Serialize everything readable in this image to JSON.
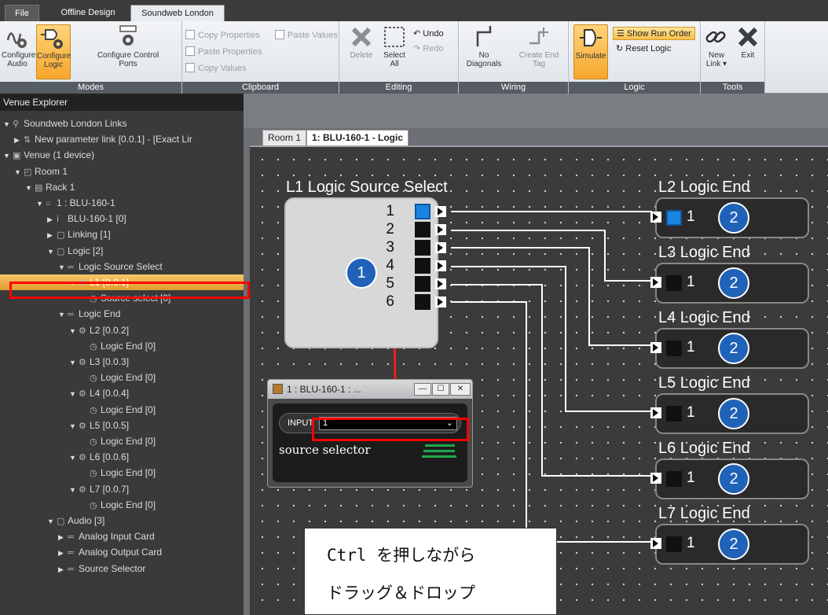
{
  "tabs": {
    "file": "File",
    "offline": "Offline Design",
    "soundweb": "Soundweb London"
  },
  "ribbon": {
    "modes": {
      "label": "Modes",
      "configure_audio": [
        "Configure",
        "Audio"
      ],
      "configure_logic": [
        "Configure",
        "Logic"
      ],
      "configure_control": [
        "Configure Control",
        "Ports"
      ]
    },
    "clipboard": {
      "label": "Clipboard",
      "copy_properties": "Copy Properties",
      "paste_values": "Paste Values",
      "paste_properties": "Paste Properties",
      "copy_values": "Copy Values"
    },
    "editing": {
      "label": "Editing",
      "delete": "Delete",
      "select_all": [
        "Select",
        "All"
      ],
      "undo": "Undo",
      "redo": "Redo"
    },
    "wiring": {
      "label": "Wiring",
      "no_diagonals": [
        "No",
        "Diagonals"
      ],
      "create_end_tag": [
        "Create End",
        "Tag"
      ]
    },
    "logic": {
      "label": "Logic",
      "simulate": "Simulate",
      "show_run_order": "Show Run Order",
      "reset_logic": "Reset Logic"
    },
    "tools": {
      "label": "Tools",
      "new_link": [
        "New",
        "Link ▾"
      ],
      "exit": "Exit"
    }
  },
  "explorer": {
    "title": "Venue Explorer",
    "items": [
      {
        "text": "Soundweb London Links",
        "depth": 0
      },
      {
        "text": "New parameter link  [0.0.1]  -  [Exact Lir",
        "depth": 1
      },
      {
        "text": "Venue (1 device)",
        "depth": 0
      },
      {
        "text": "Room 1",
        "depth": 1
      },
      {
        "text": "Rack 1",
        "depth": 2
      },
      {
        "text": "1 : BLU-160-1",
        "depth": 3
      },
      {
        "text": "BLU-160-1 [0]",
        "depth": 4
      },
      {
        "text": "Linking [1]",
        "depth": 4
      },
      {
        "text": "Logic [2]",
        "depth": 4
      },
      {
        "text": "Logic Source Select",
        "depth": 5
      },
      {
        "text": "L1 [0.0.1]",
        "depth": 6
      },
      {
        "text": "Source select [0]",
        "depth": 7
      },
      {
        "text": "Logic End",
        "depth": 5
      },
      {
        "text": "L2 [0.0.2]",
        "depth": 6
      },
      {
        "text": "Logic End [0]",
        "depth": 7
      },
      {
        "text": "L3 [0.0.3]",
        "depth": 6
      },
      {
        "text": "Logic End [0]",
        "depth": 7
      },
      {
        "text": "L4 [0.0.4]",
        "depth": 6
      },
      {
        "text": "Logic End [0]",
        "depth": 7
      },
      {
        "text": "L5 [0.0.5]",
        "depth": 6
      },
      {
        "text": "Logic End [0]",
        "depth": 7
      },
      {
        "text": "L6 [0.0.6]",
        "depth": 6
      },
      {
        "text": "Logic End [0]",
        "depth": 7
      },
      {
        "text": "L7 [0.0.7]",
        "depth": 6
      },
      {
        "text": "Logic End [0]",
        "depth": 7
      },
      {
        "text": "Audio [3]",
        "depth": 4
      },
      {
        "text": "Analog Input Card",
        "depth": 5
      },
      {
        "text": "Analog Output Card",
        "depth": 5
      },
      {
        "text": "Source Selector",
        "depth": 5
      }
    ],
    "selected_index": 10
  },
  "workspace": {
    "tab_room": "Room 1",
    "tab_logic": "1: BLU-160-1 - Logic"
  },
  "canvas": {
    "source_block": {
      "title": "L1  Logic Source Select",
      "badge": "1",
      "ports": [
        "1",
        "2",
        "3",
        "4",
        "5",
        "6"
      ],
      "active_port": 1
    },
    "end_blocks": [
      {
        "title": "L2  Logic End",
        "input": "1",
        "badge": "2",
        "active": true
      },
      {
        "title": "L3  Logic End",
        "input": "1",
        "badge": "2",
        "active": false
      },
      {
        "title": "L4  Logic End",
        "input": "1",
        "badge": "2",
        "active": false
      },
      {
        "title": "L5  Logic End",
        "input": "1",
        "badge": "2",
        "active": false
      },
      {
        "title": "L6  Logic End",
        "input": "1",
        "badge": "2",
        "active": false
      },
      {
        "title": "L7  Logic End",
        "input": "1",
        "badge": "2",
        "active": false
      }
    ]
  },
  "popup": {
    "title": "1 : BLU-160-1 : ...",
    "input_label": "INPUT",
    "input_value": "1",
    "caption": "source selector"
  },
  "callout": {
    "line1": "Ctrl を押しながら",
    "line2": "ドラッグ＆ドロップ"
  },
  "colors": {
    "annotation_red": "#ff0000",
    "selection_orange": "#f0a83a",
    "badge_blue": "#1f62b8"
  }
}
